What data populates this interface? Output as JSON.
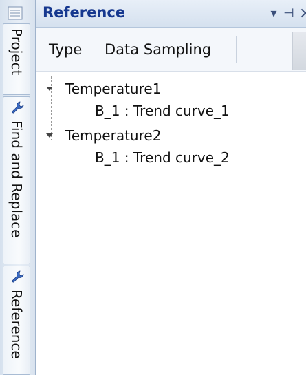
{
  "side_tabs": {
    "project": {
      "label": "Project",
      "icon": "project-icon"
    },
    "find_replace": {
      "label": "Find and Replace",
      "icon": "wrench-icon"
    },
    "reference": {
      "label": "Reference",
      "icon": "wrench-icon"
    }
  },
  "panel": {
    "title": "Reference",
    "menu_glyph": "▾",
    "pin_glyph": "⊣",
    "close_glyph": "×"
  },
  "toolbar": {
    "type_label": "Type",
    "sampling_label": "Data Sampling"
  },
  "tree": {
    "nodes": [
      {
        "label": "Temperature1",
        "children": [
          {
            "label": "B_1 : Trend curve_1"
          }
        ]
      },
      {
        "label": "Temperature2",
        "children": [
          {
            "label": "B_1 : Trend curve_2"
          }
        ]
      }
    ]
  },
  "colors": {
    "title_blue": "#16388f",
    "strip_bg": "#dfe7f1"
  }
}
